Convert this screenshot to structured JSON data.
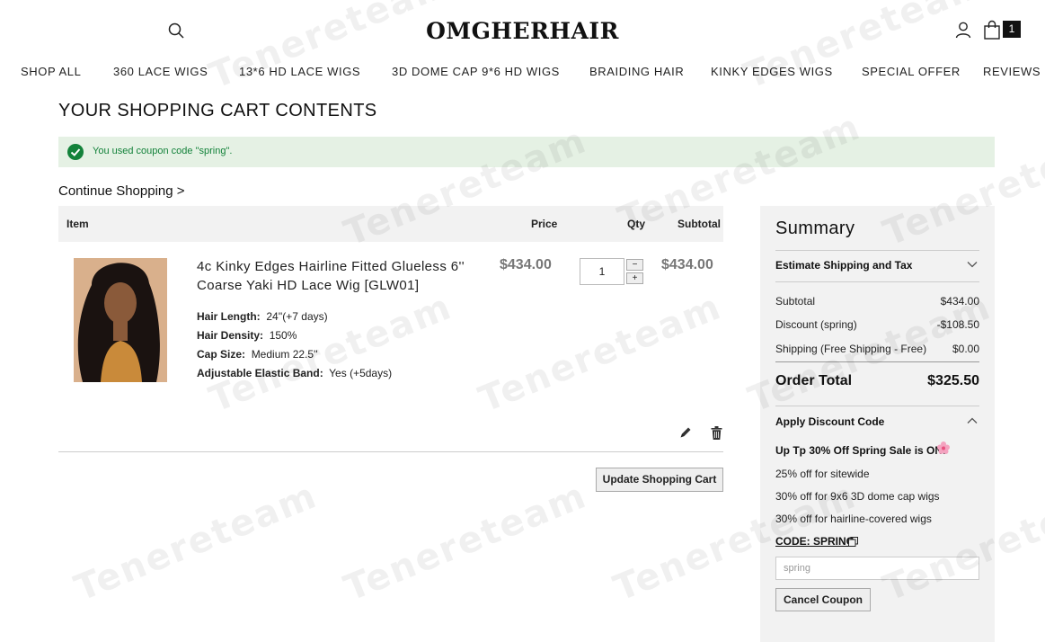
{
  "header": {
    "logo": "OMGHERHAIR",
    "cart_count": "1",
    "icons": [
      "search-icon",
      "user-icon",
      "shopping-bag-icon"
    ]
  },
  "nav": [
    "SHOP ALL",
    "360 LACE WIGS",
    "13*6 HD LACE WIGS",
    "3D DOME CAP 9*6 HD WIGS",
    "BRAIDING HAIR",
    "KINKY EDGES WIGS",
    "SPECIAL OFFER",
    "REVIEWS"
  ],
  "page_title": "YOUR SHOPPING CART CONTENTS",
  "alert": {
    "text": "You used coupon code \"spring\".",
    "color": "#13823a",
    "background": "#e5f1e4"
  },
  "continue_shopping": "Continue Shopping >",
  "cart": {
    "columns": {
      "item": "Item",
      "price": "Price",
      "qty": "Qty",
      "subtotal": "Subtotal"
    },
    "items": [
      {
        "name": "4c Kinky Edges Hairline Fitted Glueless 6'' Coarse Yaki HD Lace Wig [GLW01]",
        "price": "$434.00",
        "qty": "1",
        "subtotal": "$434.00",
        "options": [
          {
            "label": "Hair Length:",
            "value": "24''(+7 days)"
          },
          {
            "label": "Hair Density:",
            "value": "150%"
          },
          {
            "label": "Cap Size:",
            "value": "Medium 22.5''"
          },
          {
            "label": "Adjustable Elastic Band:",
            "value": "Yes (+5days)"
          }
        ]
      }
    ],
    "update_label": "Update Shopping Cart"
  },
  "summary": {
    "title": "Summary",
    "shipping_section": "Estimate Shipping and Tax",
    "rows": [
      {
        "label": "Subtotal",
        "value": "$434.00"
      },
      {
        "label": "Discount (spring)",
        "value": "-$108.50"
      },
      {
        "label": "Shipping (Free Shipping - Free)",
        "value": "$0.00"
      }
    ],
    "order_total_label": "Order Total",
    "order_total_value": "$325.50",
    "discount_section": "Apply Discount Code",
    "promo_title": "Up Tp 30% Off Spring Sale is ON!",
    "promo_lines": [
      "25% off for sitewide",
      "30% off for 9x6 3D dome cap wigs",
      "30% off for hairline-covered wigs"
    ],
    "code_text": "CODE: SPRING",
    "coupon_value": "spring",
    "cancel_label": "Cancel Coupon"
  },
  "watermark": "Tenereteam"
}
